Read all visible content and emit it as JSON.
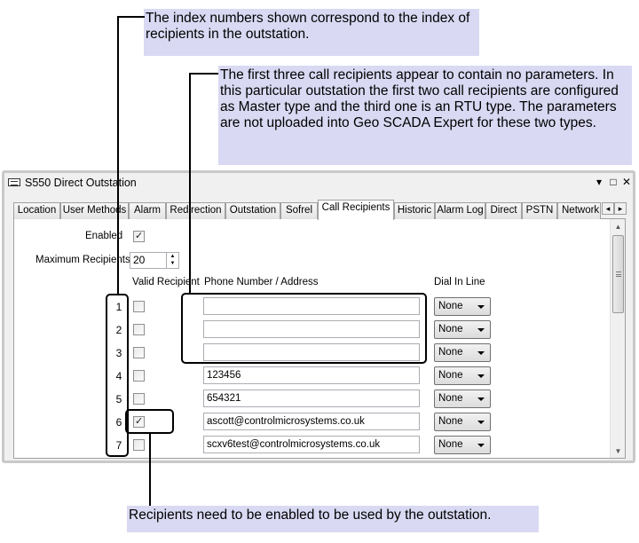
{
  "callouts": {
    "index_note": "The index numbers shown correspond to the index of recipients in the outstation.",
    "params_note": "The first three call recipients appear to contain no parameters. In this particular outstation the first two call recipients are configured as Master type and the third one is an RTU type. The parameters are not uploaded into Geo SCADA Expert for these two types.",
    "enabled_note": "Recipients need to be enabled to be used by the outstation."
  },
  "window": {
    "title": "S550 Direct Outstation",
    "controls": [
      "▾",
      "□",
      "✕"
    ]
  },
  "tabs": [
    {
      "label": "Location",
      "active": false
    },
    {
      "label": "User Methods",
      "active": false
    },
    {
      "label": "Alarm",
      "active": false
    },
    {
      "label": "Redirection",
      "active": false
    },
    {
      "label": "Outstation",
      "active": false
    },
    {
      "label": "Sofrel",
      "active": false
    },
    {
      "label": "Call Recipients",
      "active": true
    },
    {
      "label": "Historic",
      "active": false
    },
    {
      "label": "Alarm Log",
      "active": false
    },
    {
      "label": "Direct",
      "active": false
    },
    {
      "label": "PSTN",
      "active": false
    },
    {
      "label": "Network",
      "active": false
    }
  ],
  "form": {
    "enabled_label": "Enabled",
    "enabled": true,
    "max_recipients_label": "Maximum Recipients",
    "max_recipients_value": "20",
    "col_valid": "Valid Recipient",
    "col_phone": "Phone Number / Address",
    "col_dial": "Dial In Line"
  },
  "recipients": [
    {
      "index": "1",
      "valid": false,
      "phone": "",
      "dial": "None"
    },
    {
      "index": "2",
      "valid": false,
      "phone": "",
      "dial": "None"
    },
    {
      "index": "3",
      "valid": false,
      "phone": "",
      "dial": "None"
    },
    {
      "index": "4",
      "valid": false,
      "phone": "123456",
      "dial": "None"
    },
    {
      "index": "5",
      "valid": false,
      "phone": "654321",
      "dial": "None"
    },
    {
      "index": "6",
      "valid": true,
      "phone": "ascott@controlmicrosystems.co.uk",
      "dial": "None"
    },
    {
      "index": "7",
      "valid": false,
      "phone": "scxv6test@controlmicrosystems.co.uk",
      "dial": "None"
    }
  ],
  "icons": {
    "app": "window-app-icon",
    "tab_left": "◂",
    "tab_right": "▸",
    "scroll_up": "▲",
    "scroll_down": "▼"
  }
}
